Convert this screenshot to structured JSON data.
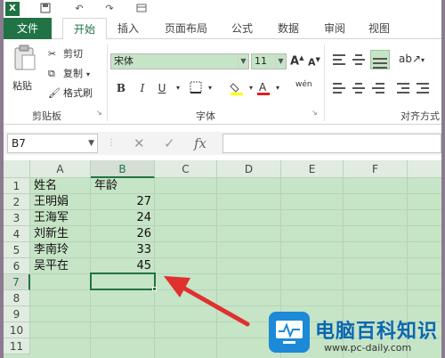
{
  "app": {
    "logo_letter": "X"
  },
  "tabs": [
    {
      "label": "文件"
    },
    {
      "label": "开始"
    },
    {
      "label": "插入"
    },
    {
      "label": "页面布局"
    },
    {
      "label": "公式"
    },
    {
      "label": "数据"
    },
    {
      "label": "审阅"
    },
    {
      "label": "视图"
    }
  ],
  "ribbon": {
    "clipboard": {
      "paste_label": "粘贴",
      "cut_label": "剪切",
      "copy_label": "复制",
      "format_painter_label": "格式刷",
      "group_label": "剪贴板"
    },
    "font": {
      "font_name": "宋体",
      "font_size": "11",
      "bold": "B",
      "italic": "I",
      "underline": "U",
      "grow": "A",
      "shrink": "A",
      "group_label": "字体",
      "phonetic": "wén"
    },
    "alignment": {
      "group_label": "对齐方式"
    }
  },
  "formula_bar": {
    "name_box": "B7",
    "fx_label": "fx",
    "value": ""
  },
  "sheet": {
    "columns": [
      "A",
      "B",
      "C",
      "D",
      "E",
      "F"
    ],
    "rows": [
      "1",
      "2",
      "3",
      "4",
      "5",
      "6",
      "7",
      "8",
      "9",
      "10",
      "11"
    ],
    "cells": {
      "A1": "姓名",
      "B1": "年龄",
      "A2": "王明娟",
      "B2": "27",
      "A3": "王海军",
      "B3": "24",
      "A4": "刘新生",
      "B4": "26",
      "A5": "李南玲",
      "B5": "33",
      "A6": "吴平在",
      "B6": "45"
    },
    "selected_cell": "B7"
  },
  "watermark": {
    "title": "电脑百科知识",
    "url": "www.pc-daily.com"
  },
  "colors": {
    "accent": "#217346",
    "grid_bg": "#c6e4c6",
    "arrow": "#e03030",
    "watermark_blue": "#1c8ad6"
  }
}
